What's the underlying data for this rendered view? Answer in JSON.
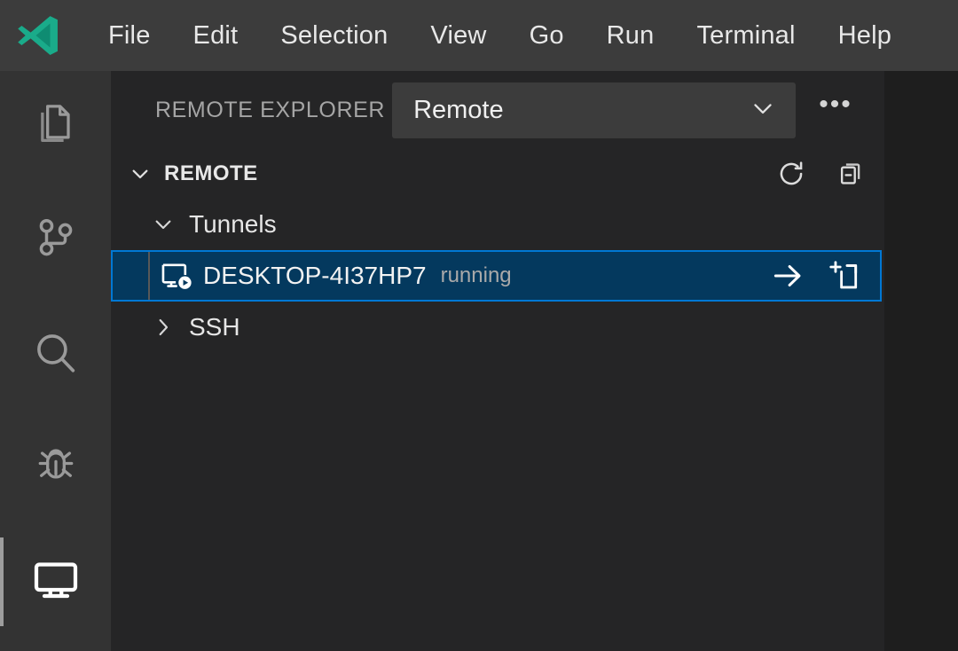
{
  "titlebar": {
    "logo_icon": "vscode-logo-icon",
    "logo_color": "#1aab8a",
    "background": "#3c3c3c",
    "menus": [
      {
        "label": "File"
      },
      {
        "label": "Edit"
      },
      {
        "label": "Selection"
      },
      {
        "label": "View"
      },
      {
        "label": "Go"
      },
      {
        "label": "Run"
      },
      {
        "label": "Terminal"
      },
      {
        "label": "Help"
      }
    ]
  },
  "activitybar": {
    "background": "#333333",
    "items": [
      {
        "name": "explorer",
        "icon": "files-icon",
        "active": false
      },
      {
        "name": "source-control",
        "icon": "source-control-branch-icon",
        "active": false
      },
      {
        "name": "search",
        "icon": "search-icon",
        "active": false
      },
      {
        "name": "run-and-debug",
        "icon": "bug-icon",
        "active": false
      },
      {
        "name": "remote-explorer",
        "icon": "remote-monitor-icon",
        "active": true
      }
    ]
  },
  "sidebar": {
    "background": "#252526",
    "title": "REMOTE EXPLORER",
    "view_select": {
      "value": "Remote",
      "chevron_icon": "chevron-down-icon"
    },
    "more_actions_label": "•••",
    "section": {
      "title": "REMOTE",
      "expanded": true,
      "twisty_icon": "chevron-down-icon",
      "actions": [
        {
          "name": "refresh",
          "icon": "refresh-icon"
        },
        {
          "name": "collapse-all",
          "icon": "collapse-all-icon"
        }
      ]
    },
    "tree": [
      {
        "label": "Tunnels",
        "level": 1,
        "expanded": true,
        "twisty_icon": "chevron-down-icon",
        "selected": false
      },
      {
        "label": "DESKTOP-4I37HP7",
        "description": "running",
        "level": 2,
        "selected": true,
        "item_icon": "vm-running-icon",
        "actions": [
          {
            "name": "connect-in-current-window",
            "icon": "arrow-right-icon"
          },
          {
            "name": "connect-in-new-window",
            "icon": "empty-window-icon"
          }
        ]
      },
      {
        "label": "SSH",
        "level": 1,
        "expanded": false,
        "twisty_icon": "chevron-right-icon",
        "selected": false
      }
    ]
  },
  "editor": {
    "background": "#1e1e1e"
  },
  "colors": {
    "selection_background": "#04395e",
    "selection_border": "#0078d4",
    "accent": "#1aab8a",
    "text_primary": "#e6e6e6",
    "text_muted": "#a9a9a9"
  }
}
